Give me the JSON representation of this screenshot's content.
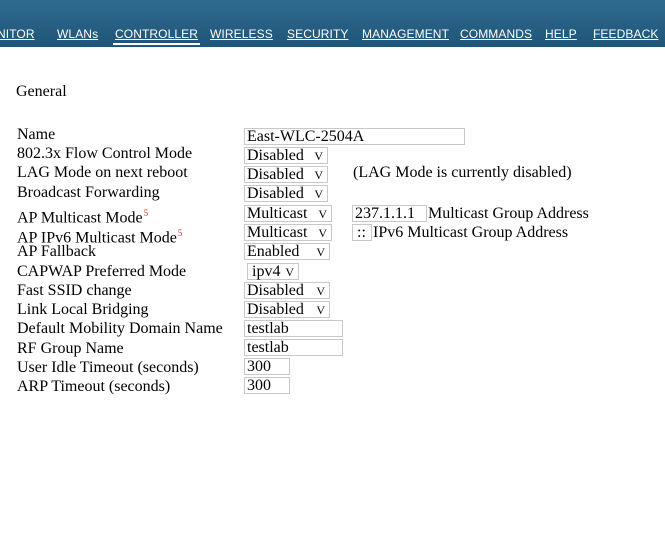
{
  "nav": {
    "items": [
      {
        "label": "NITOR"
      },
      {
        "label": "WLANs"
      },
      {
        "label": "CONTROLLER",
        "active": true
      },
      {
        "label": "WIRELESS"
      },
      {
        "label": "SECURITY"
      },
      {
        "label": "MANAGEMENT"
      },
      {
        "label": "COMMANDS"
      },
      {
        "label": "HELP"
      },
      {
        "label": "FEEDBACK"
      }
    ]
  },
  "page": {
    "section_title": "General"
  },
  "form": {
    "name": {
      "label": "Name",
      "value": "East-WLC-2504A"
    },
    "flow_control": {
      "label": "802.3x Flow Control Mode",
      "value": "Disabled"
    },
    "lag_mode": {
      "label": "LAG Mode on next reboot",
      "value": "Disabled",
      "note": "(LAG Mode is currently disabled)"
    },
    "broadcast_forwarding": {
      "label": "Broadcast Forwarding",
      "value": "Disabled"
    },
    "ap_multicast": {
      "label": "AP Multicast Mode",
      "marker": "5",
      "value": "Multicast",
      "group_address": "237.1.1.1",
      "group_label": "Multicast Group Address"
    },
    "ap_ipv6_multicast": {
      "label": "AP IPv6 Multicast Mode",
      "marker": "5",
      "value": "Multicast",
      "group_address": "::",
      "group_label": "IPv6 Multicast Group Address"
    },
    "ap_fallback": {
      "label": "AP Fallback",
      "value": "Enabled"
    },
    "capwap_mode": {
      "label": "CAPWAP Preferred Mode",
      "value": "ipv4"
    },
    "fast_ssid": {
      "label": "Fast SSID change",
      "value": "Disabled"
    },
    "link_local_bridging": {
      "label": "Link Local Bridging",
      "value": "Disabled"
    },
    "mobility_domain": {
      "label": "Default Mobility Domain Name",
      "value": "testlab"
    },
    "rf_group": {
      "label": "RF Group Name",
      "value": "testlab"
    },
    "idle_timeout": {
      "label": "User Idle Timeout (seconds)",
      "value": "300"
    },
    "arp_timeout": {
      "label": "ARP Timeout (seconds)",
      "value": "300"
    }
  },
  "icons": {
    "dropdown": "chevron-down-icon",
    "dropdown_glyph": "V"
  },
  "colors": {
    "navbar": "#2f6b91",
    "nav_text": "#ffffff",
    "marker": "#c0392b",
    "field_border": "#c8c8c8"
  }
}
